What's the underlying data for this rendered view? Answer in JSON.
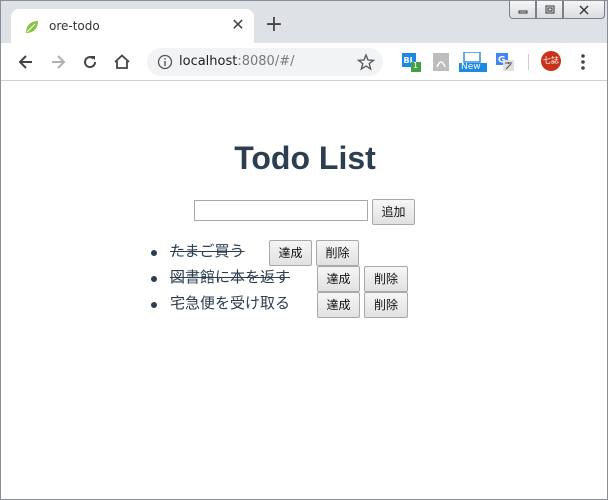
{
  "browser": {
    "tab_title": "ore-todo",
    "tab_close": "✕",
    "new_tab": "+",
    "url_host": "localhost",
    "url_rest": ":8080/#/",
    "extensions": {
      "bl_badge": "1",
      "new_label": "New"
    },
    "profile_label": "七誌"
  },
  "page": {
    "title": "Todo List",
    "new_todo": {
      "value": "",
      "placeholder": ""
    },
    "add_label": "追加",
    "todos": [
      {
        "text": "たまご買う",
        "done": true,
        "complete_label": "達成",
        "delete_label": "削除"
      },
      {
        "text": "図書館に本を返す",
        "done": true,
        "complete_label": "達成",
        "delete_label": "削除"
      },
      {
        "text": "宅急便を受け取る",
        "done": false,
        "complete_label": "達成",
        "delete_label": "削除"
      }
    ]
  },
  "colors": {
    "title": "#2c3e50",
    "tabstrip": "#dee1e6",
    "omnibox": "#f1f3f4",
    "favicon": "#8bc34a",
    "profile": "#c8321a"
  },
  "icons": [
    "leaf-favicon-icon",
    "close-icon",
    "plus-icon",
    "back-arrow-icon",
    "forward-arrow-icon",
    "reload-icon",
    "home-icon",
    "info-icon",
    "star-icon",
    "bl-extension-icon",
    "pdf-extension-icon",
    "new-extension-icon",
    "translate-extension-icon",
    "kebab-menu-icon"
  ]
}
